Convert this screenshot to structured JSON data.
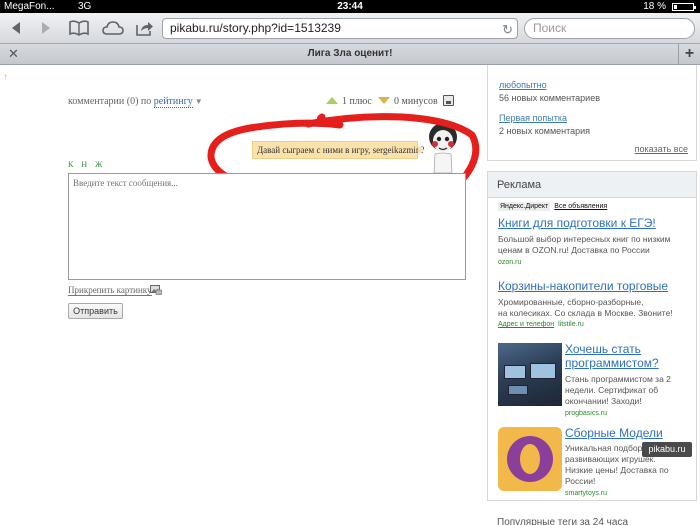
{
  "status_bar": {
    "carrier": "MegaFon...",
    "network": "3G",
    "time": "23:44",
    "battery": "18 %",
    "battery_level": 0.18
  },
  "toolbar": {
    "url": "pikabu.ru/story.php?id=1513239",
    "search_placeholder": "Поиск"
  },
  "tab": {
    "title": "Лига Зла оценит!"
  },
  "comments": {
    "sort_label": "комментарии (0) по",
    "sort_value": "рейтингу",
    "plus": "1 плюс",
    "minus": "0 минусов",
    "bubble": "Давай сыграем с ними в игру, sergeikazmin?",
    "format_links": "К Н Ж",
    "textarea_placeholder": "Введите текст сообщения...",
    "attach_label": "Прикрепить картинку",
    "send_label": "Отправить"
  },
  "sidebar": {
    "items": [
      {
        "title": "любопытно",
        "count": "56 новых комментариев"
      },
      {
        "title": "Первая попытка",
        "count": "2 новых комментария"
      }
    ],
    "show_all": "показать все"
  },
  "ads": {
    "header": "Реклама",
    "yandex_label": "Яндекс.Директ",
    "all_ads": "Все объявления",
    "items": [
      {
        "title": "Книги для подготовки к ЕГЭ!",
        "text_lines": [
          "Большой выбор интересных книг по низким",
          "ценам в OZON.ru! Доставка по России"
        ],
        "domain": "ozon.ru"
      },
      {
        "title": "Корзины-накопители торговые",
        "text_lines": [
          "Хромированные, сборно-разборные,",
          "на колесиках. Со склада в Москве. Звоните!"
        ],
        "contact": "Адрес и телефон",
        "domain": "litstile.ru"
      },
      {
        "title_lines": [
          "Хочешь стать",
          "программистом?"
        ],
        "text_lines": [
          "Стань программистом за 2",
          "недели. Сертификат об",
          "окончании! Заходи!"
        ],
        "domain": "progbasics.ru"
      },
      {
        "title_lines": [
          "Сборные Модели"
        ],
        "text_lines": [
          "Уникальная подборка",
          "развивающих игрушек.",
          "Низкие цены! Доставка по",
          "России!"
        ],
        "domain": "smartytoys.ru"
      }
    ]
  },
  "bottom_cut_text": "Популярные теги за 24 часа",
  "watermark": "pikabu.ru"
}
